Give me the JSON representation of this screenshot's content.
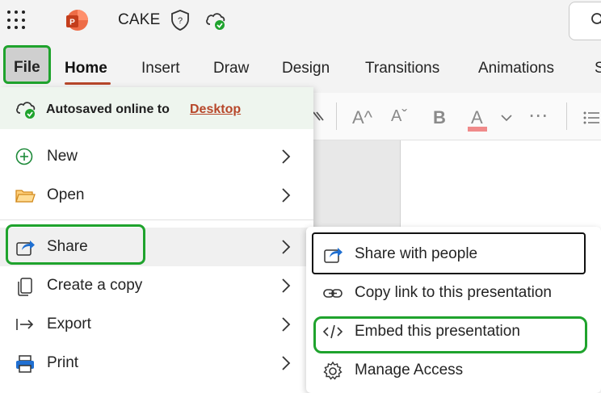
{
  "app": {
    "doc_title": "CAKE"
  },
  "tabs": [
    {
      "label": "File"
    },
    {
      "label": "Home"
    },
    {
      "label": "Insert"
    },
    {
      "label": "Draw"
    },
    {
      "label": "Design"
    },
    {
      "label": "Transitions"
    },
    {
      "label": "Animations"
    },
    {
      "label": "S"
    }
  ],
  "ribbon": {
    "font_size_up": "A^",
    "font_size_down": "Aˇ",
    "bold": "B",
    "font_color": "A",
    "more": "⋯"
  },
  "file_menu": {
    "autosave_text": "Autosaved online to",
    "autosave_location": "Desktop",
    "items": [
      {
        "label": "New",
        "icon": "plus-circle-icon"
      },
      {
        "label": "Open",
        "icon": "folder-icon"
      },
      {
        "label": "Share",
        "icon": "share-icon"
      },
      {
        "label": "Create a copy",
        "icon": "copy-icon"
      },
      {
        "label": "Export",
        "icon": "export-icon"
      },
      {
        "label": "Print",
        "icon": "print-icon"
      }
    ]
  },
  "share_submenu": {
    "items": [
      {
        "label": "Share with people",
        "icon": "share-icon"
      },
      {
        "label": "Copy link to this presentation",
        "icon": "link-icon"
      },
      {
        "label": "Embed this presentation",
        "icon": "embed-code-icon"
      },
      {
        "label": "Manage Access",
        "icon": "gear-icon"
      }
    ]
  },
  "colors": {
    "accent": "#b7472a",
    "highlight_annotation": "#1fa32d"
  }
}
